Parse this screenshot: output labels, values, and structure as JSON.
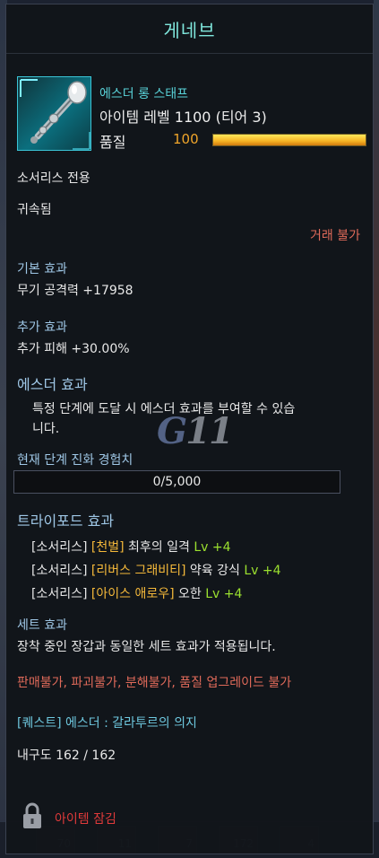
{
  "item": {
    "name": "게네브",
    "type": "에스더 롱 스태프",
    "level_text": "아이템 레벨 1100 (티어 3)",
    "quality_label": "품질",
    "quality_value": "100",
    "quality_fraction": 1.0,
    "class_restrict": "소서리스 전용",
    "bound": "귀속됨",
    "trade": "거래 불가"
  },
  "basic_effect": {
    "header": "기본 효과",
    "line": "무기 공격력 +17958"
  },
  "extra_effect": {
    "header": "추가 효과",
    "line": "추가 피해 +30.00%"
  },
  "esther_effect": {
    "header": "에스더 효과",
    "line1": "특정 단계에 도달 시 에스더 효과를 부여할 수 있습",
    "line2": "니다."
  },
  "evolution": {
    "header": "현재 단계 진화 경험치",
    "value": "0/5,000"
  },
  "tripod": {
    "header": "트라이포드 효과",
    "items": [
      {
        "cls": "[소서리스]",
        "rune": "[천벌]",
        "skill": "최후의 일격",
        "lv": "Lv +4"
      },
      {
        "cls": "[소서리스]",
        "rune": "[리버스 그래비티]",
        "skill": "약육 강식",
        "lv": "Lv +4"
      },
      {
        "cls": "[소서리스]",
        "rune": "[아이스 애로우]",
        "skill": "오한",
        "lv": "Lv +4"
      }
    ]
  },
  "set_effect": {
    "header": "세트 효과",
    "line": "장착 중인 장갑과 동일한 세트 효과가 적용됩니다."
  },
  "restrictions": "판매불가, 파괴불가, 분해불가, 품질 업그레이드 불가",
  "quest": "[퀘스트] 에스더 : 갈라투르의 의지",
  "durability": "내구도 162 / 162",
  "lock": "아이템 잠김",
  "watermark": {
    "g": "G",
    "num": "11"
  },
  "background_slots": [
    "70",
    "11",
    "7",
    "172",
    "4"
  ],
  "colors": {
    "title": "#7fe6dc",
    "quality": "#f0a52a",
    "warning": "#e06a5a",
    "lock": "#e03a3a",
    "quest": "#6ec8df",
    "level_up": "#9be02f",
    "rune": "#f5b93a"
  }
}
